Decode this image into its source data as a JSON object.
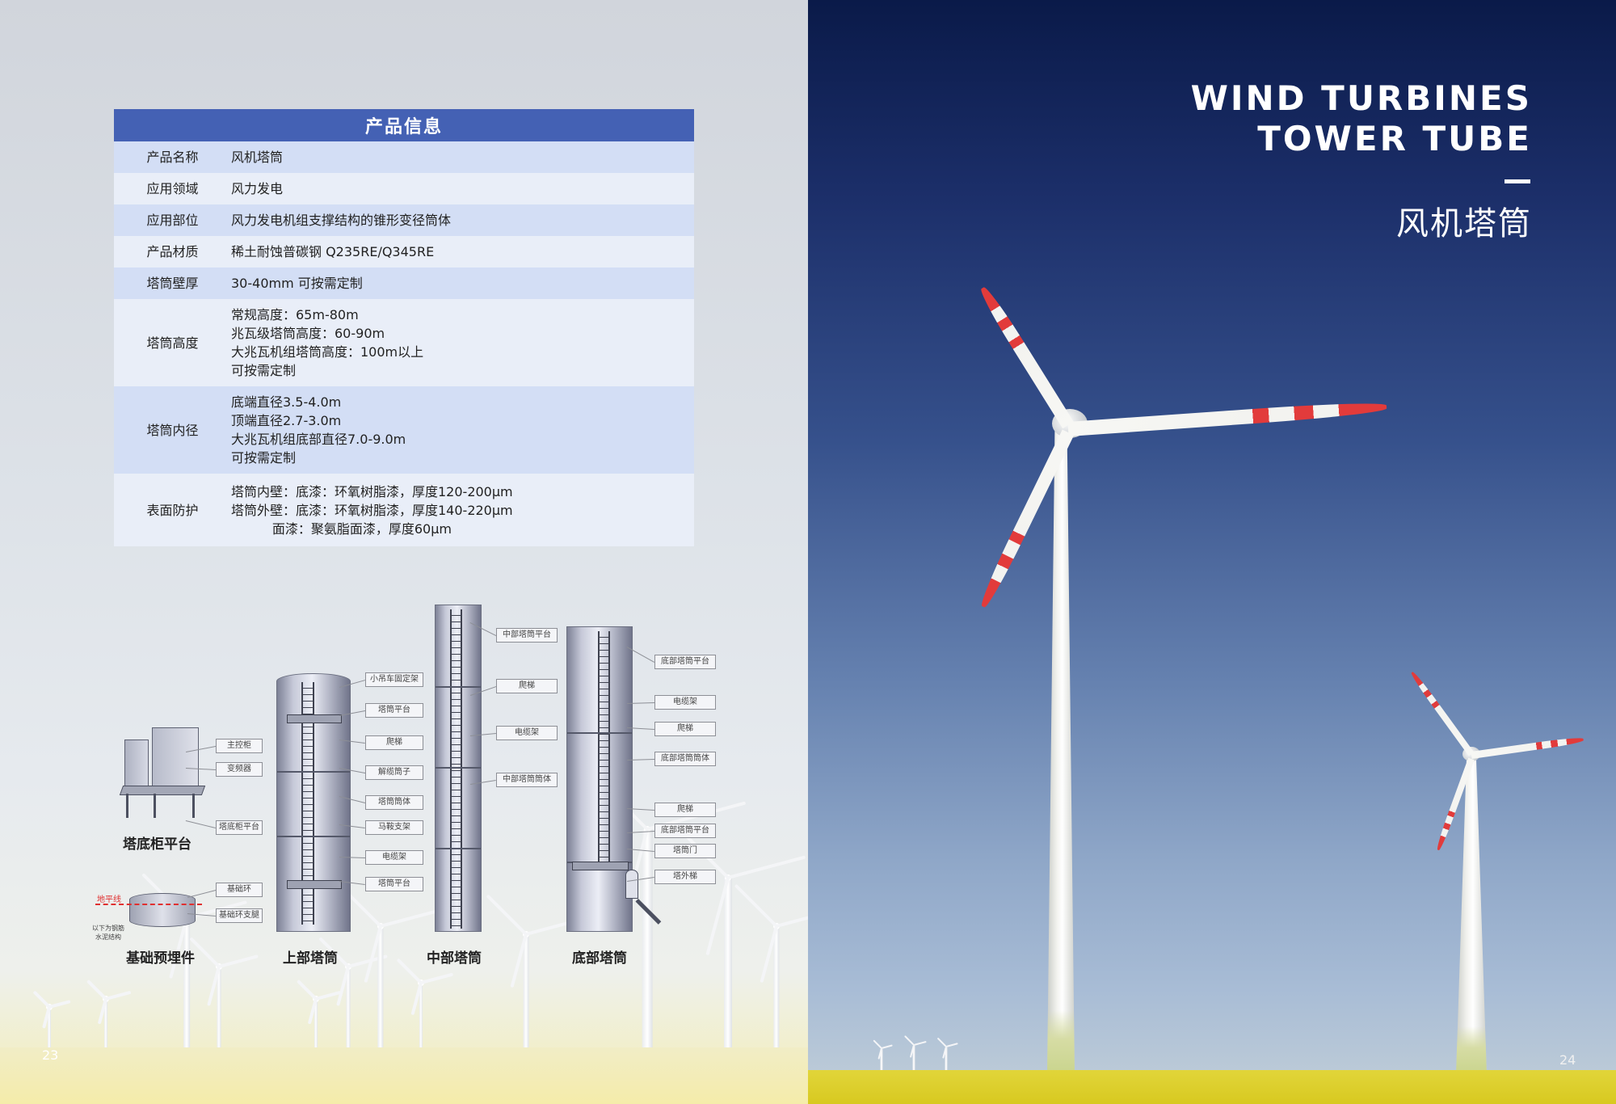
{
  "left_page": {
    "page_number": "23",
    "table": {
      "title": "产品信息",
      "rows": [
        {
          "key": "产品名称",
          "lines": [
            "风机塔筒"
          ]
        },
        {
          "key": "应用领域",
          "lines": [
            "风力发电"
          ]
        },
        {
          "key": "应用部位",
          "lines": [
            "风力发电机组支撑结构的锥形变径筒体"
          ]
        },
        {
          "key": "产品材质",
          "lines": [
            "稀土耐蚀普碳钢 Q235RE/Q345RE"
          ]
        },
        {
          "key": "塔筒壁厚",
          "lines": [
            "30-40mm 可按需定制"
          ]
        },
        {
          "key": "塔筒高度",
          "lines": [
            "常规高度：65m-80m",
            "兆瓦级塔筒高度：60-90m",
            "大兆瓦机组塔筒高度：100m以上",
            "可按需定制"
          ]
        },
        {
          "key": "塔筒内径",
          "lines": [
            "底端直径3.5-4.0m",
            "顶端直径2.7-3.0m",
            "大兆瓦机组底部直径7.0-9.0m",
            "可按需定制"
          ]
        },
        {
          "key": "表面防护",
          "lines": [
            "塔筒内壁：底漆：环氧树脂漆，厚度120-200μm",
            "塔筒外壁：底漆：环氧树脂漆，厚度140-220μm",
            "          面漆：聚氨脂面漆，厚度60μm"
          ]
        }
      ]
    },
    "diagram": {
      "component_labels": {
        "cabinet_platform": "塔底柜平台",
        "foundation": "基础预埋件",
        "upper_tower": "上部塔筒",
        "middle_tower": "中部塔筒",
        "bottom_tower": "底部塔筒"
      },
      "ground_line_label": "地平线",
      "foundation_note": [
        "以下为钢筋",
        "水泥结构"
      ],
      "callouts": {
        "cabinet": [
          "主控柜",
          "变频器",
          "塔底柜平台"
        ],
        "foundation": [
          "基础环",
          "基础环支腿"
        ],
        "upper": [
          "小吊车固定架",
          "塔筒平台",
          "爬梯",
          "解缆筒子",
          "塔筒筒体",
          "马鞍支架",
          "电缆架",
          "塔筒平台"
        ],
        "middle": [
          "中部塔筒平台",
          "爬梯",
          "电缆架",
          "中部塔筒筒体"
        ],
        "bottom": [
          "底部塔筒平台",
          "电缆架",
          "爬梯",
          "底部塔筒筒体",
          "爬梯",
          "底部塔筒平台",
          "塔筒门",
          "塔外梯"
        ]
      }
    }
  },
  "right_page": {
    "page_number": "24",
    "title_en_lines": [
      "WIND TURBINES",
      "TOWER TUBE"
    ],
    "title_dash": "—",
    "title_cn": "风机塔筒"
  },
  "colors": {
    "table_header": "#4461b4",
    "table_row_odd": "#d3def5",
    "table_row_even": "#e9eef8",
    "blade_stripe": "#e23b3b",
    "field_yellow": "#ddd02e",
    "sky_top": "#0a1a49"
  }
}
